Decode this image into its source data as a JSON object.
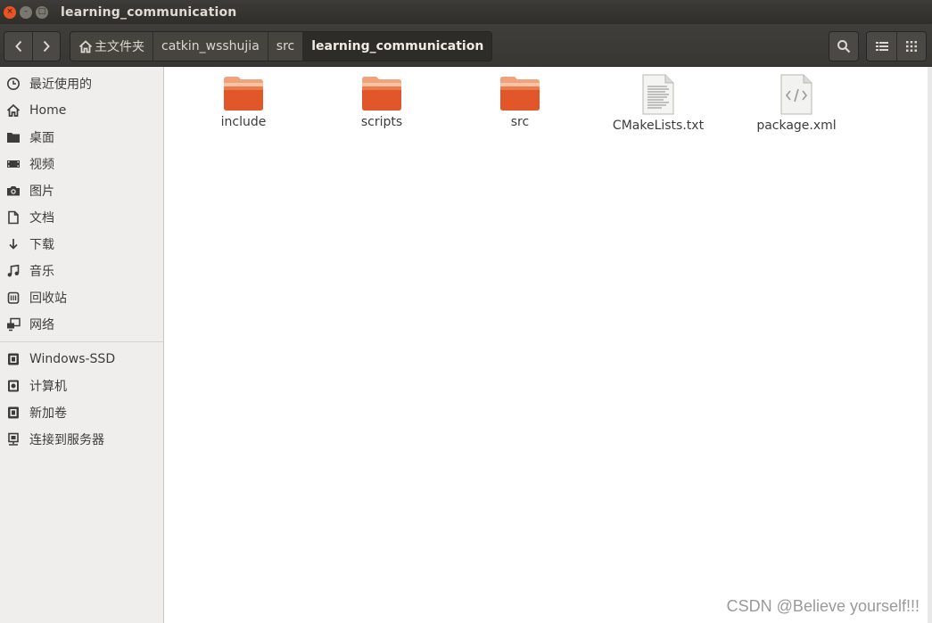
{
  "window": {
    "title": "learning_communication",
    "close_glyph": "×",
    "min_glyph": "–",
    "max_glyph": "□"
  },
  "toolbar": {
    "back_glyph": "‹",
    "forward_glyph": "›",
    "breadcrumbs": [
      {
        "label": "主文件夹",
        "icon": "home-icon"
      },
      {
        "label": "catkin_wsshujia"
      },
      {
        "label": "src"
      },
      {
        "label": "learning_communication",
        "active": true
      }
    ]
  },
  "sidebar": {
    "places": [
      {
        "label": "最近使用的",
        "icon": "clock-icon"
      },
      {
        "label": "Home",
        "icon": "home-icon"
      },
      {
        "label": "桌面",
        "icon": "folder-icon"
      },
      {
        "label": "视频",
        "icon": "video-icon"
      },
      {
        "label": "图片",
        "icon": "camera-icon"
      },
      {
        "label": "文档",
        "icon": "document-icon"
      },
      {
        "label": "下载",
        "icon": "download-icon"
      },
      {
        "label": "音乐",
        "icon": "music-icon"
      },
      {
        "label": "回收站",
        "icon": "trash-icon"
      },
      {
        "label": "网络",
        "icon": "network-icon"
      }
    ],
    "devices": [
      {
        "label": "Windows-SSD",
        "icon": "drive-icon"
      },
      {
        "label": "计算机",
        "icon": "computer-icon"
      },
      {
        "label": "新加卷",
        "icon": "drive-icon"
      },
      {
        "label": "连接到服务器",
        "icon": "server-icon"
      }
    ]
  },
  "files": [
    {
      "name": "include",
      "type": "folder"
    },
    {
      "name": "scripts",
      "type": "folder"
    },
    {
      "name": "src",
      "type": "folder"
    },
    {
      "name": "CMakeLists.txt",
      "type": "text"
    },
    {
      "name": "package.xml",
      "type": "xml"
    }
  ],
  "watermark": "CSDN @Believe yourself!!!",
  "colors": {
    "accent": "#e95420",
    "folder_top": "#f39b6a",
    "folder_body": "#e2572a",
    "titlebar": "#3d3c39",
    "sidebar_bg": "#efeeec"
  }
}
